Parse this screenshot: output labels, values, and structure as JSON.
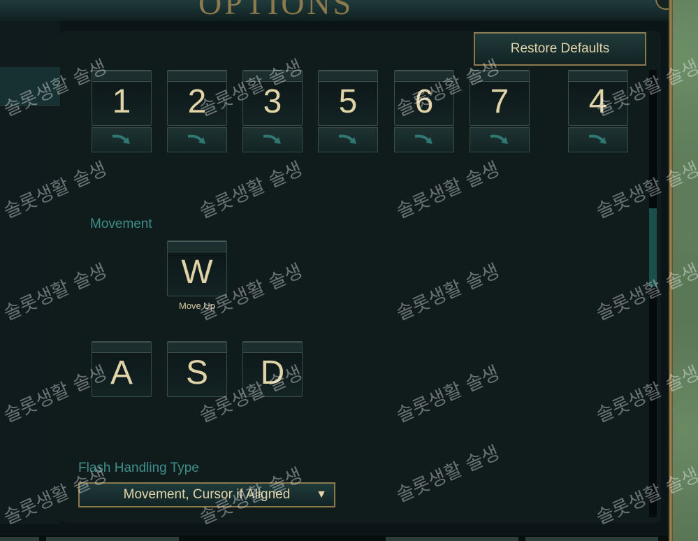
{
  "window": {
    "title": "OPTIONS"
  },
  "actions": {
    "restore_defaults_label": "Restore Defaults"
  },
  "item_keys": [
    {
      "label": "1"
    },
    {
      "label": "2"
    },
    {
      "label": "3"
    },
    {
      "label": "5"
    },
    {
      "label": "6"
    },
    {
      "label": "7"
    },
    {
      "label": "4"
    }
  ],
  "movement": {
    "section_label": "Movement",
    "up": {
      "label": "W",
      "caption": "Move Up"
    },
    "left": {
      "label": "A"
    },
    "down": {
      "label": "S"
    },
    "right": {
      "label": "D"
    }
  },
  "flash": {
    "section_label": "Flash Handling Type",
    "selected": "Movement, Cursor if Aligned",
    "arrow": "▼"
  },
  "watermark": {
    "text": "솔롯생활 솔생"
  },
  "colors": {
    "gold": "#8c7a4c",
    "teal_label": "#3f8f8a",
    "key_text": "#e1d3a8"
  }
}
